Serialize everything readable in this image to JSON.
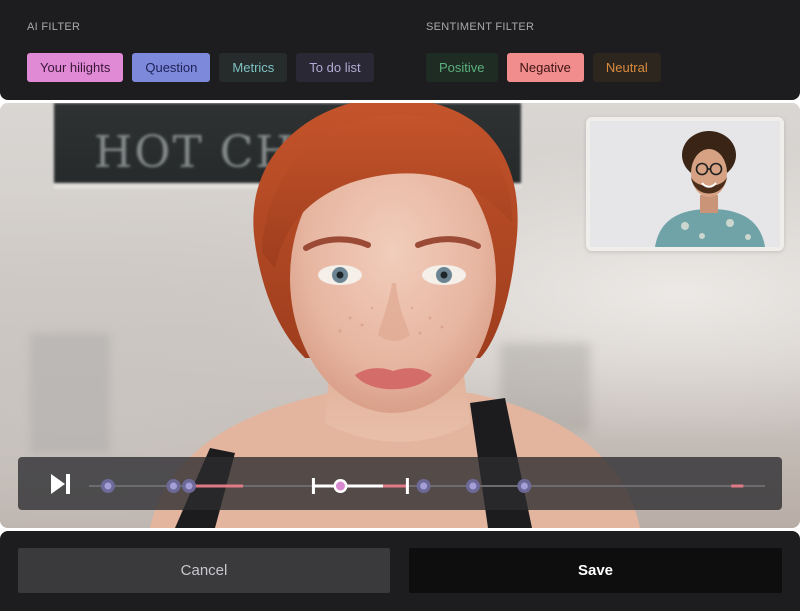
{
  "ai_filter": {
    "title": "AI FILTER",
    "chips": [
      {
        "label": "Your hilights",
        "color": "#e08ad6"
      },
      {
        "label": "Question",
        "color": "#7d89db"
      },
      {
        "label": "Metrics",
        "color": "#7ec3c4"
      },
      {
        "label": "To do list",
        "color": "#b3abd6"
      }
    ]
  },
  "sentiment_filter": {
    "title": "SENTIMENT FILTER",
    "chips": [
      {
        "label": "Positive",
        "color": "#5bb07c"
      },
      {
        "label": "Negative",
        "color": "#f28d8d"
      },
      {
        "label": "Neutral",
        "color": "#d98c3e"
      }
    ]
  },
  "video": {
    "background_sign_text": "HOT CH",
    "pip_icon": "participant-thumbnail"
  },
  "player": {
    "play_icon": "play-pause-icon",
    "playhead_fraction": 0.372,
    "selection_start_fraction": 0.332,
    "selection_end_fraction": 0.471,
    "markers_fraction": [
      0.028,
      0.125,
      0.148,
      0.372,
      0.495,
      0.568,
      0.644
    ],
    "highlight_segments_fraction": [
      [
        0.148,
        0.228
      ],
      [
        0.435,
        0.471
      ],
      [
        0.95,
        0.968
      ]
    ]
  },
  "actions": {
    "cancel_label": "Cancel",
    "save_label": "Save"
  },
  "colors": {
    "panel_bg": "#1d1d1f",
    "accent_pink": "#e08ad6",
    "marker_purple": "#8e86c9",
    "highlight_red": "#f28d8d"
  }
}
